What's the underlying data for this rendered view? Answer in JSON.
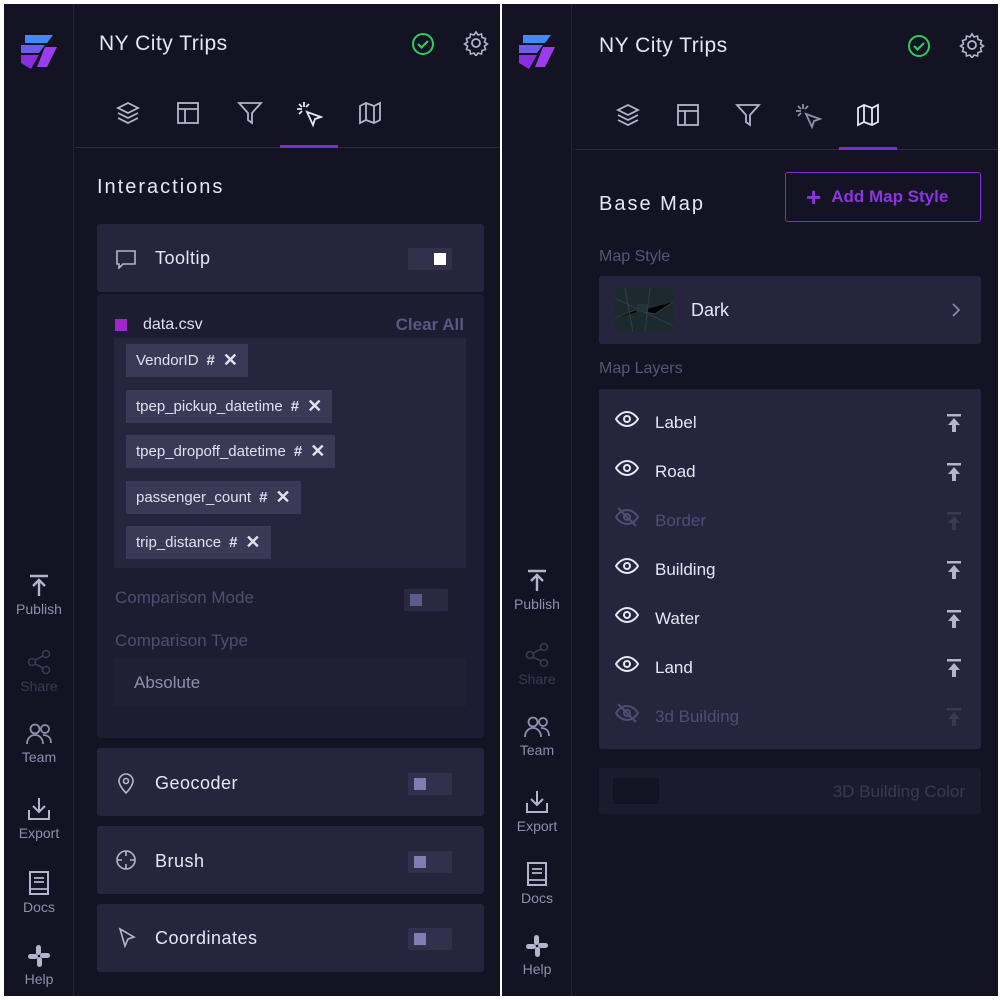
{
  "app": {
    "title": "NY City Trips"
  },
  "colors": {
    "accent": "#7b2fd3",
    "ok": "#2ecc5f",
    "bg": "#141323",
    "card": "#26253d"
  },
  "rail": {
    "publish": "Publish",
    "share": "Share",
    "team": "Team",
    "export": "Export",
    "docs": "Docs",
    "help": "Help"
  },
  "tabs": [
    "layers",
    "layout",
    "filter",
    "interactions",
    "base-map"
  ],
  "interactions": {
    "title": "Interactions",
    "tooltip": {
      "label": "Tooltip",
      "enabled": true,
      "dataset": "data.csv",
      "clear_all": "Clear All",
      "fields": [
        "VendorID",
        "tpep_pickup_datetime",
        "tpep_dropoff_datetime",
        "passenger_count",
        "trip_distance"
      ],
      "field_type_symbol": "#",
      "remove_symbol": "✕",
      "comparison_mode": "Comparison Mode",
      "comparison_type": "Comparison Type",
      "comparison_value": "Absolute"
    },
    "geocoder": {
      "label": "Geocoder",
      "enabled": false
    },
    "brush": {
      "label": "Brush",
      "enabled": false
    },
    "coordinates": {
      "label": "Coordinates",
      "enabled": false
    }
  },
  "base_map": {
    "title": "Base Map",
    "add_style": "Add Map Style",
    "map_style_label": "Map Style",
    "map_style_value": "Dark",
    "map_layers_label": "Map Layers",
    "layers": [
      {
        "name": "Label",
        "visible": true
      },
      {
        "name": "Road",
        "visible": true
      },
      {
        "name": "Border",
        "visible": false
      },
      {
        "name": "Building",
        "visible": true
      },
      {
        "name": "Water",
        "visible": true
      },
      {
        "name": "Land",
        "visible": true
      },
      {
        "name": "3d Building",
        "visible": false
      }
    ],
    "building_color_label": "3D Building Color"
  }
}
